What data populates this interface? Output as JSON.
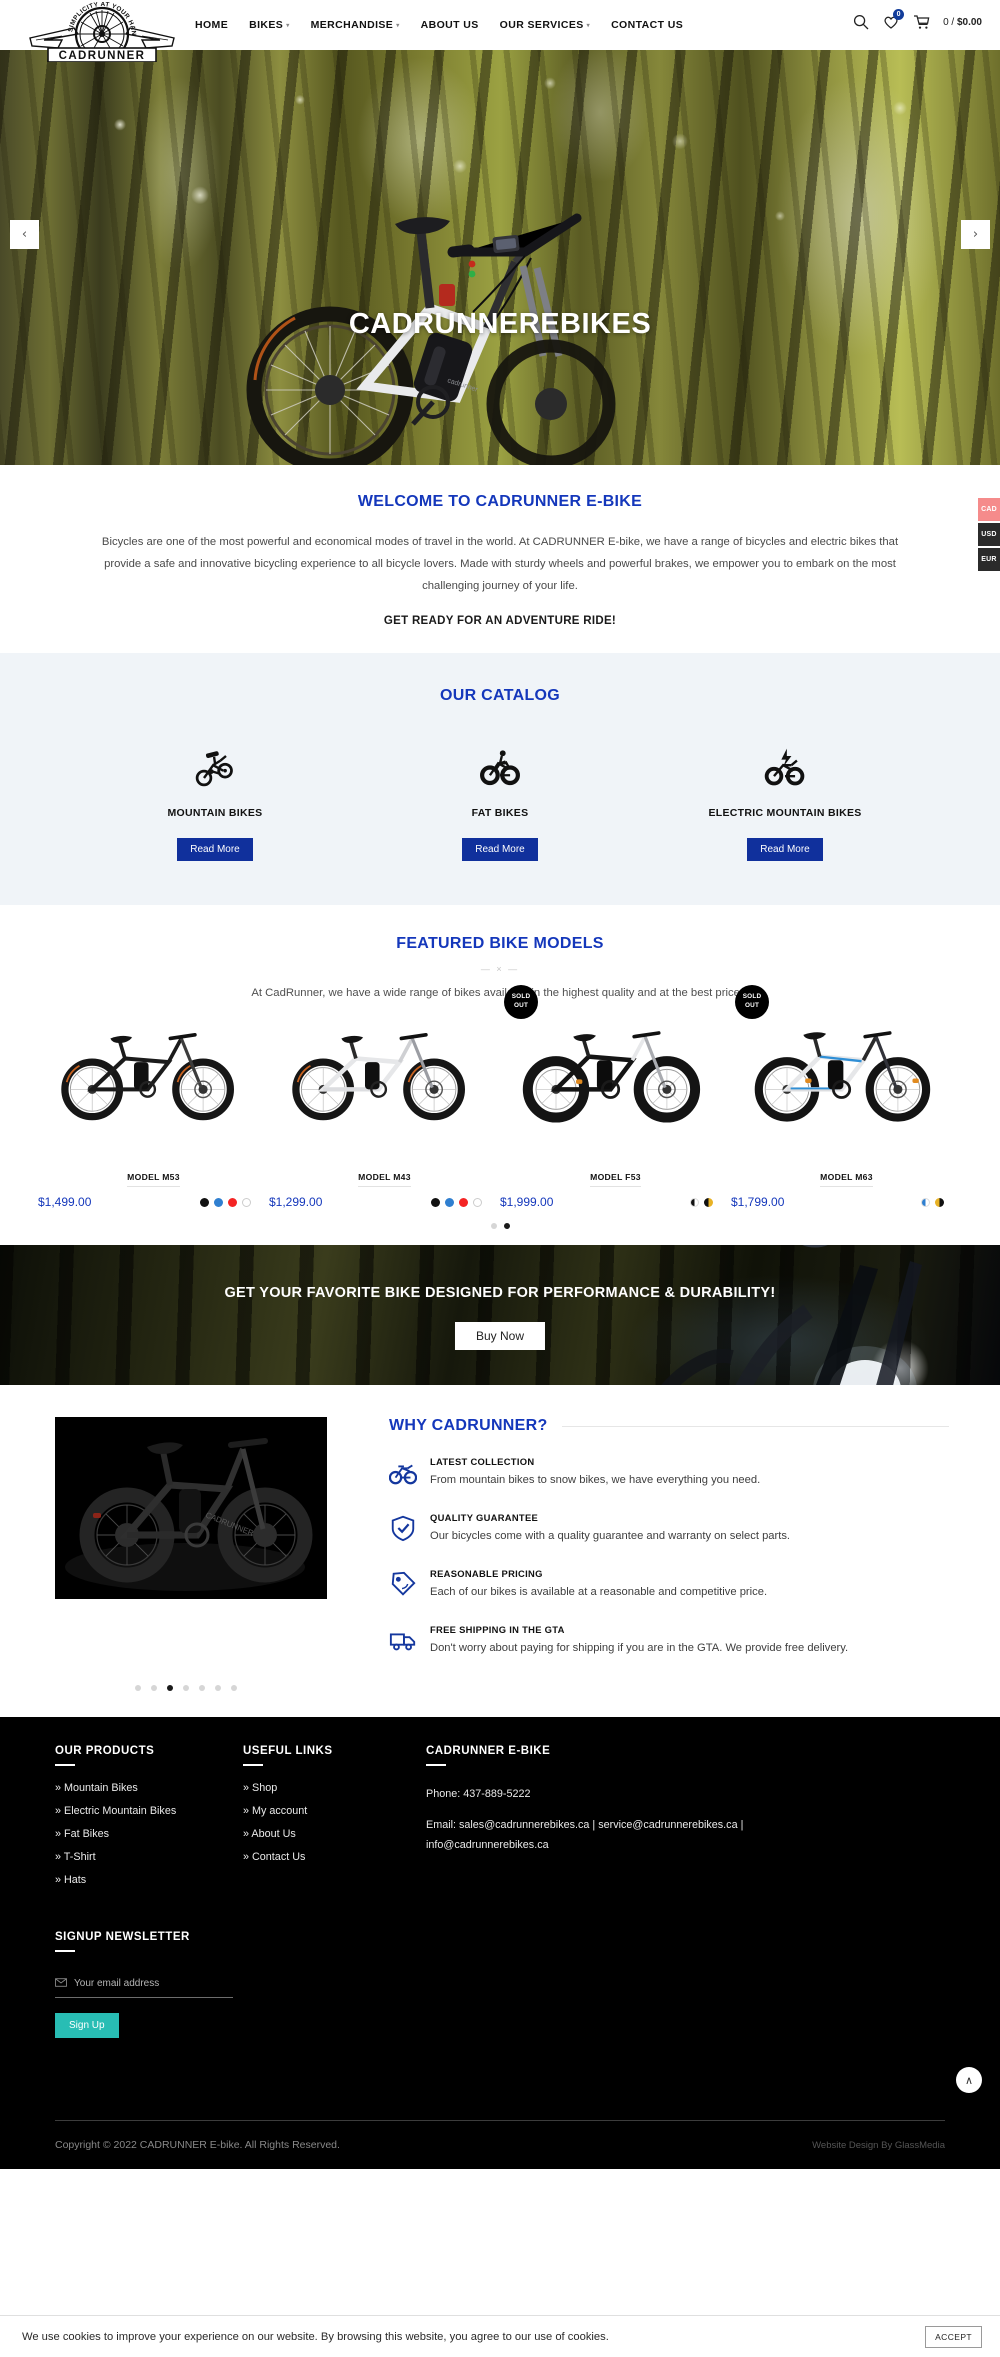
{
  "brand": {
    "logo_tagline": "SIMPLICITY AT YOUR HANDS",
    "logo_name": "CADRUNNER"
  },
  "header": {
    "nav": [
      {
        "label": "HOME",
        "has_caret": false
      },
      {
        "label": "BIKES",
        "has_caret": true
      },
      {
        "label": "MERCHANDISE",
        "has_caret": true
      },
      {
        "label": "ABOUT US",
        "has_caret": false
      },
      {
        "label": "OUR SERVICES",
        "has_caret": true
      },
      {
        "label": "CONTACT US",
        "has_caret": false
      }
    ],
    "wishlist_count": "0",
    "cart_text_count": "0 / ",
    "cart_total": "$0.00",
    "accent_blue": "#123c9a"
  },
  "hero": {
    "title": "CADRUNNEREBIKES",
    "prev": "‹",
    "next": "›"
  },
  "currency": {
    "options": [
      {
        "code": "CAD",
        "active": true
      },
      {
        "code": "USD",
        "active": false
      },
      {
        "code": "EUR",
        "active": false
      }
    ],
    "active_color": "#f58b8b"
  },
  "welcome": {
    "title": "WELCOME TO CADRUNNER E-BIKE",
    "body": "Bicycles are one of the most powerful and economical modes of travel in the world. At CADRUNNER E-bike, we have a range of bicycles and electric bikes that provide a safe and innovative bicycling experience to all bicycle lovers. Made with sturdy wheels and powerful brakes, we empower you to embark on the most challenging journey of your life.",
    "cta": "GET READY FOR AN ADVENTURE RIDE!"
  },
  "catalog": {
    "title": "OUR CATALOG",
    "items": [
      {
        "label": "MOUNTAIN BIKES",
        "icon": "mountain-bike-icon",
        "button": "Read More"
      },
      {
        "label": "FAT BIKES",
        "icon": "fat-bike-icon",
        "button": "Read More"
      },
      {
        "label": "ELECTRIC MOUNTAIN BIKES",
        "icon": "electric-bike-icon",
        "button": "Read More"
      }
    ],
    "button_color": "#10309c",
    "bg": "#f0f4f8"
  },
  "featured": {
    "title": "FEATURED BIKE MODELS",
    "divider": "— × —",
    "subtitle": "At CadRunner, we have a wide range of bikes available in the highest quality and at the best prices.",
    "products": [
      {
        "name": "MODEL M53",
        "price": "$1,499.00",
        "sold_out": false,
        "badge": "",
        "frame": "black",
        "swatches": [
          "#111111",
          "#2f7fd0",
          "#f42424",
          "#ffffff"
        ]
      },
      {
        "name": "MODEL M43",
        "price": "$1,299.00",
        "sold_out": false,
        "badge": "",
        "frame": "white",
        "swatches": [
          "#111111",
          "#2f7fd0",
          "#f42424",
          "#ffffff"
        ]
      },
      {
        "name": "MODEL F53",
        "price": "$1,999.00",
        "sold_out": true,
        "badge": "SOLD OUT",
        "frame": "black",
        "swatches": [
          "#111111",
          "#e8b225"
        ]
      },
      {
        "name": "MODEL M63",
        "price": "$1,799.00",
        "sold_out": true,
        "badge": "SOLD OUT",
        "frame": "white-blue",
        "swatches": [
          "#2f7fd0",
          "#e8b225"
        ]
      }
    ],
    "sold_out_label_line1": "SOLD",
    "sold_out_label_line2": "OUT",
    "carousel_dots": 2,
    "carousel_active": 1
  },
  "cta_banner": {
    "title": "GET YOUR FAVORITE BIKE DESIGNED FOR PERFORMANCE & DURABILITY!",
    "button": "Buy Now"
  },
  "why": {
    "title": "WHY CADRUNNER?",
    "features": [
      {
        "icon": "bicycle-icon",
        "title": "LATEST COLLECTION",
        "text": "From mountain bikes to snow bikes, we have everything you need."
      },
      {
        "icon": "shield-check-icon",
        "title": "QUALITY GUARANTEE",
        "text": "Our bicycles come with a quality guarantee and warranty on select parts."
      },
      {
        "icon": "price-tag-icon",
        "title": "REASONABLE PRICING",
        "text": "Each of our bikes is available at a reasonable and competitive price."
      },
      {
        "icon": "delivery-truck-icon",
        "title": "FREE SHIPPING IN THE GTA",
        "text": "Don't worry about paying for shipping if you are in the GTA. We provide free delivery."
      }
    ],
    "dots": 7,
    "dot_active": 2,
    "accent": "#1437bb"
  },
  "footer": {
    "products_heading": "OUR PRODUCTS",
    "products": [
      "» Mountain Bikes",
      "» Electric Mountain Bikes",
      "» Fat Bikes",
      "» T-Shirt",
      "» Hats"
    ],
    "links_heading": "USEFUL LINKS",
    "links": [
      "» Shop",
      "» My account",
      "» About Us",
      "» Contact Us"
    ],
    "contact_heading": "CADRUNNER E-BIKE",
    "phone": "Phone: 437-889-5222",
    "email": "Email: sales@cadrunnerebikes.ca | service@cadrunnerebikes.ca | info@cadrunnerebikes.ca",
    "newsletter_heading": "SIGNUP NEWSLETTER",
    "newsletter_placeholder": "Your email address",
    "newsletter_value": "",
    "signup_button": "Sign Up",
    "signup_color": "#28bdb4",
    "copyright": "Copyright © 2022 CADRUNNER E-bike. All Rights Reserved.",
    "credit": "Website Design By GlassMedia",
    "to_top": "∧"
  },
  "cookie": {
    "text": "We use cookies to improve your experience on our website. By browsing this website, you agree to our use of cookies.",
    "accept": "ACCEPT"
  }
}
